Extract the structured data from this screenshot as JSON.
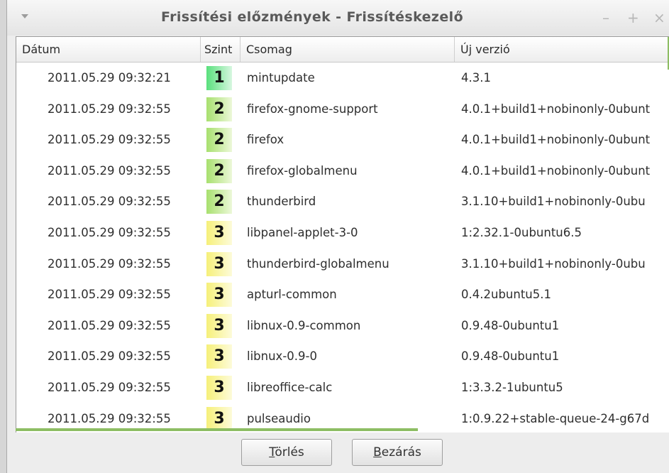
{
  "window": {
    "title": "Frissítési előzmények - Frissítéskezelő",
    "controls": {
      "minimize": "–",
      "maximize": "+",
      "close": "×"
    }
  },
  "table": {
    "headers": {
      "date": "Dátum",
      "level": "Szint",
      "package": "Csomag",
      "new_version": "Új verzió"
    },
    "rows": [
      {
        "date": "2011.05.29 09:32:21",
        "level": "1",
        "package": "mintupdate",
        "new_version": "4.3.1"
      },
      {
        "date": "2011.05.29 09:32:55",
        "level": "2",
        "package": "firefox-gnome-support",
        "new_version": "4.0.1+build1+nobinonly-0ubunt"
      },
      {
        "date": "2011.05.29 09:32:55",
        "level": "2",
        "package": "firefox",
        "new_version": "4.0.1+build1+nobinonly-0ubunt"
      },
      {
        "date": "2011.05.29 09:32:55",
        "level": "2",
        "package": "firefox-globalmenu",
        "new_version": "4.0.1+build1+nobinonly-0ubunt"
      },
      {
        "date": "2011.05.29 09:32:55",
        "level": "2",
        "package": "thunderbird",
        "new_version": "3.1.10+build1+nobinonly-0ubu"
      },
      {
        "date": "2011.05.29 09:32:55",
        "level": "3",
        "package": "libpanel-applet-3-0",
        "new_version": "1:2.32.1-0ubuntu6.5"
      },
      {
        "date": "2011.05.29 09:32:55",
        "level": "3",
        "package": "thunderbird-globalmenu",
        "new_version": "3.1.10+build1+nobinonly-0ubu"
      },
      {
        "date": "2011.05.29 09:32:55",
        "level": "3",
        "package": "apturl-common",
        "new_version": "0.4.2ubuntu5.1"
      },
      {
        "date": "2011.05.29 09:32:55",
        "level": "3",
        "package": "libnux-0.9-common",
        "new_version": "0.9.48-0ubuntu1"
      },
      {
        "date": "2011.05.29 09:32:55",
        "level": "3",
        "package": "libnux-0.9-0",
        "new_version": "0.9.48-0ubuntu1"
      },
      {
        "date": "2011.05.29 09:32:55",
        "level": "3",
        "package": "libreoffice-calc",
        "new_version": "1:3.3.2-1ubuntu5"
      },
      {
        "date": "2011.05.29 09:32:55",
        "level": "3",
        "package": "pulseaudio",
        "new_version": "1:0.9.22+stable-queue-24-g67d"
      }
    ]
  },
  "buttons": {
    "delete": {
      "mnemonic": "T",
      "rest": "örlés"
    },
    "close": {
      "mnemonic": "B",
      "rest": "ezárás"
    }
  },
  "colors": {
    "level_1": "#59e07d",
    "level_2": "#a8e06f",
    "level_3": "#f6f07a",
    "accent": "#8dbd63"
  }
}
